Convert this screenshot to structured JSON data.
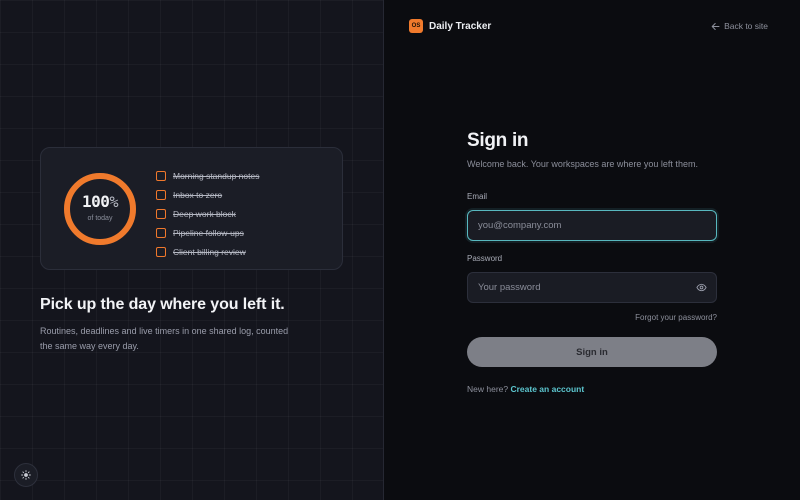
{
  "brand": {
    "logo_text": "OS",
    "name": "Daily Tracker"
  },
  "nav": {
    "back_label": "Back to site"
  },
  "hero": {
    "progress_value": "100",
    "progress_unit": "%",
    "progress_fraction": 1.0,
    "progress_caption": "of today",
    "tasks": [
      {
        "label": "Morning standup notes",
        "done": true
      },
      {
        "label": "Inbox to zero",
        "done": true
      },
      {
        "label": "Deep work block",
        "done": true
      },
      {
        "label": "Pipeline follow-ups",
        "done": true
      },
      {
        "label": "Client billing review",
        "done": true
      }
    ],
    "headline": "Pick up the day where you left it.",
    "subtext": "Routines, deadlines and live timers in one shared log, counted the same way every day."
  },
  "form": {
    "title": "Sign in",
    "subtitle": "Welcome back. Your workspaces are where you left them.",
    "email_label": "Email",
    "email_placeholder": "you@company.com",
    "email_value": "",
    "password_label": "Password",
    "password_placeholder": "Your password",
    "password_value": "",
    "forgot_label": "Forgot your password?",
    "submit_label": "Sign in",
    "signup_prompt": "New here?",
    "signup_link": "Create an account"
  },
  "icons": {
    "theme_toggle": "sun-icon",
    "back": "arrow-left-icon",
    "password_visibility": "eye-icon"
  },
  "colors": {
    "accent": "#f07a2c",
    "link": "#5cc6cf",
    "focus_ring": "#58b8bf",
    "button_disabled": "#7d7f87"
  }
}
